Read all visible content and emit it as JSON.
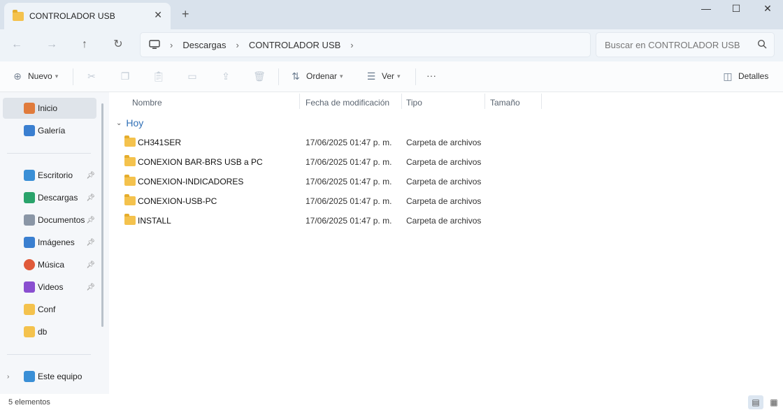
{
  "window": {
    "tab_title": "CONTROLADOR USB",
    "new_tab": "+",
    "close_tab": "✕",
    "minimize": "—",
    "maximize": "☐",
    "close": "✕"
  },
  "nav": {
    "back": "←",
    "forward": "→",
    "up": "↑",
    "refresh": "↻",
    "breadcrumb": [
      "Descargas",
      "CONTROLADOR USB"
    ],
    "search_placeholder": "Buscar en CONTROLADOR USB"
  },
  "toolbar": {
    "new_label": "Nuevo",
    "sort_label": "Ordenar",
    "view_label": "Ver",
    "more_label": "···",
    "details_label": "Detalles"
  },
  "sidebar": {
    "items": [
      {
        "label": "Inicio",
        "icon": "home-icon",
        "color": "#e07b3c",
        "pinned": false
      },
      {
        "label": "Galería",
        "icon": "gallery-icon",
        "color": "#3a7fd0",
        "pinned": false
      },
      {
        "label": "Escritorio",
        "icon": "desktop-icon",
        "color": "#3a8fd6",
        "pinned": true
      },
      {
        "label": "Descargas",
        "icon": "download-icon",
        "color": "#2aa36b",
        "pinned": true
      },
      {
        "label": "Documentos",
        "icon": "document-icon",
        "color": "#8a96a6",
        "pinned": true
      },
      {
        "label": "Imágenes",
        "icon": "image-icon",
        "color": "#3a7fd0",
        "pinned": true
      },
      {
        "label": "Música",
        "icon": "music-icon",
        "color": "#e05a3a",
        "pinned": true
      },
      {
        "label": "Videos",
        "icon": "video-icon",
        "color": "#8a4fd0",
        "pinned": true
      },
      {
        "label": "Conf",
        "icon": "folder-icon",
        "color": "#f4c24d",
        "pinned": false
      },
      {
        "label": "db",
        "icon": "folder-icon",
        "color": "#f4c24d",
        "pinned": false
      },
      {
        "label": "Este equipo",
        "icon": "computer-icon",
        "color": "#3a8fd6",
        "pinned": false
      }
    ]
  },
  "columns": {
    "name": "Nombre",
    "date": "Fecha de modificación",
    "type": "Tipo",
    "size": "Tamaño"
  },
  "group": {
    "label": "Hoy"
  },
  "files": [
    {
      "name": "CH341SER",
      "date": "17/06/2025 01:47 p. m.",
      "type": "Carpeta de archivos"
    },
    {
      "name": "CONEXION BAR-BRS USB a PC",
      "date": "17/06/2025 01:47 p. m.",
      "type": "Carpeta de archivos"
    },
    {
      "name": "CONEXION-INDICADORES",
      "date": "17/06/2025 01:47 p. m.",
      "type": "Carpeta de archivos"
    },
    {
      "name": "CONEXION-USB-PC",
      "date": "17/06/2025 01:47 p. m.",
      "type": "Carpeta de archivos"
    },
    {
      "name": "INSTALL",
      "date": "17/06/2025 01:47 p. m.",
      "type": "Carpeta de archivos"
    }
  ],
  "status": {
    "items_text": "5 elementos"
  }
}
